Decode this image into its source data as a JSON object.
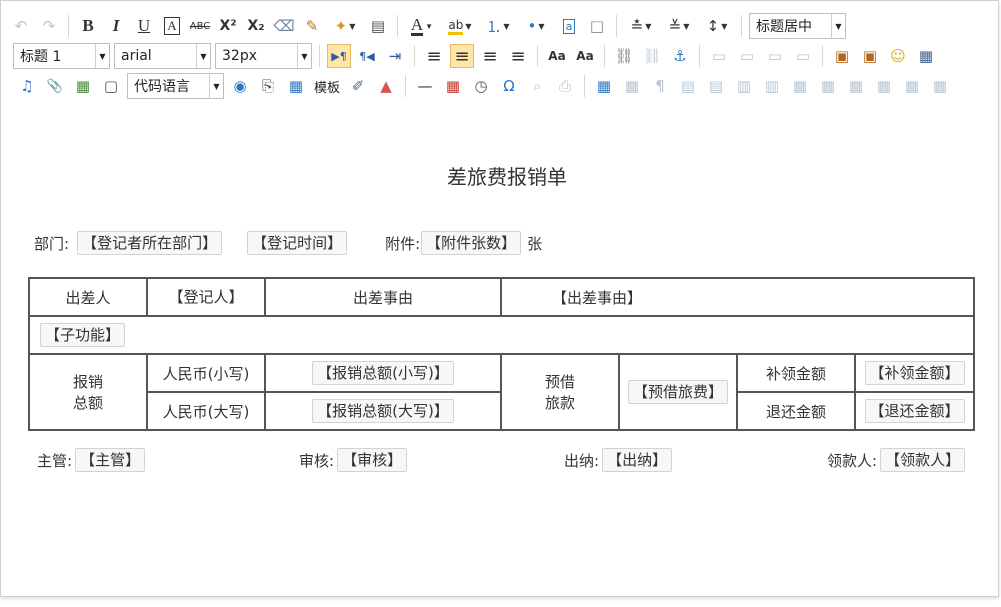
{
  "toolbar": {
    "heading_style": "标题 1",
    "font_family": "arial",
    "font_size": "32px",
    "title_align": "标题居中",
    "code_language": "代码语言",
    "template_label": "模板",
    "glyphs": {
      "undo": "↶",
      "redo": "↷",
      "bold": "B",
      "italic": "I",
      "underline": "U",
      "font_border": "A",
      "strikethrough": "ABC",
      "superscript": "X²",
      "subscript": "X₂",
      "eraser": "⌫",
      "format_brush": "✎",
      "auto_format": "✦",
      "paste_plain": "▤",
      "font_color": "A",
      "back_color": "ab",
      "ordered_list": "⒈",
      "unordered_list": "•",
      "cite": "a",
      "blank_page": "□",
      "row_spacing_top": "≛",
      "row_spacing_bottom": "≚",
      "line_height": "↕",
      "dropdown": "▼",
      "ltr": "▶¶",
      "rtl": "¶◀",
      "indent": "⇥",
      "justify_left": "≡",
      "justify_center": "≡",
      "justify_right": "≡",
      "justify_full": "≡",
      "to_upper": "Aa",
      "to_lower": "Aa",
      "link": "⛓",
      "unlink": "⛓",
      "anchor": "⚓",
      "image_none": "▭",
      "image_left": "▭",
      "image_right": "▭",
      "image_center": "▭",
      "simple_upload": "▣",
      "insert_image": "▣",
      "emotion": "☺",
      "video": "▦",
      "music": "♫",
      "attachment": "📎",
      "map": "▦",
      "frame": "▢",
      "gmap": "◉",
      "pagebreak": "⎘",
      "background": "▦",
      "scrawl": "✐",
      "chart": "▲",
      "horizontal": "—",
      "date": "▦",
      "time": "◷",
      "special_chars": "Ω",
      "search_replace": "⌕",
      "print": "⎙",
      "insert_table": "▦",
      "delete_table": "▦",
      "insert_paragraph": "¶",
      "insert_row": "▤",
      "delete_row": "▤",
      "insert_col": "▥",
      "delete_col": "▥",
      "merge_cells": "▦",
      "merge_right": "▦",
      "merge_down": "▦",
      "split_to_cells": "▦",
      "split_to_rows": "▦",
      "split_to_cols": "▦"
    }
  },
  "document": {
    "title": "差旅费报销单",
    "dept_label": "部门:",
    "dept_field": "【登记者所在部门】",
    "time_field": "【登记时间】",
    "attach_label": "附件:",
    "attach_field": "【附件张数】",
    "attach_unit": "张",
    "table": {
      "traveler_label": "出差人",
      "traveler_field": "【登记人】",
      "reason_label": "出差事由",
      "reason_field": "【出差事由】",
      "subfunction_field": "【子功能】",
      "total_label_1": "报销",
      "total_label_2": "总额",
      "rmb_small_label": "人民币(小写)",
      "rmb_small_field": "【报销总额(小写)】",
      "rmb_big_label": "人民币(大写)",
      "rmb_big_field": "【报销总额(大写)】",
      "advance_label_1": "预借",
      "advance_label_2": "旅款",
      "advance_field": "【预借旅费】",
      "supplement_label": "补领金额",
      "supplement_field": "【补领金额】",
      "refund_label": "退还金额",
      "refund_field": "【退还金额】"
    },
    "signatures": {
      "supervisor_label": "主管:",
      "supervisor_field": "【主管】",
      "reviewer_label": "审核:",
      "reviewer_field": "【审核】",
      "cashier_label": "出纳:",
      "cashier_field": "【出纳】",
      "payee_label": "领款人:",
      "payee_field": "【领款人】"
    }
  }
}
